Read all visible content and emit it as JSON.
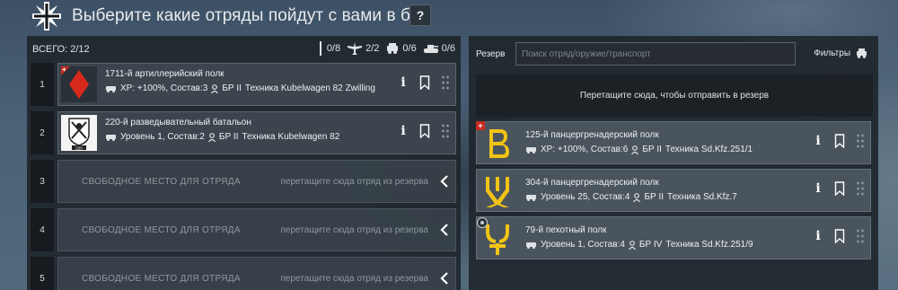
{
  "header": {
    "title": "Выберите какие отряды пойдут с вами в бой",
    "help_label": "?"
  },
  "left": {
    "total_label": "ВСЕГО: 2/12",
    "counts": [
      {
        "icon": "infantry-icon",
        "value": "0/8"
      },
      {
        "icon": "aircraft-icon",
        "value": "2/2"
      },
      {
        "icon": "vehicle-icon",
        "value": "0/6"
      },
      {
        "icon": "tank-icon",
        "value": "0/6"
      }
    ],
    "slots": [
      {
        "number": "1",
        "name": "1711-й артиллерийский полк",
        "info_text": "XP: +100%, Состав:3",
        "br": "БР II",
        "tech": "Техника Kubelwagen 82 Zwilling",
        "emblem": "red-diamond",
        "emblem_color": "#d6291c"
      },
      {
        "number": "2",
        "name": "220-й разведывательный батальон",
        "info_text": "Уровень 1, Состав:2",
        "br": "БР II",
        "tech": "Техника Kubelwagen 82",
        "emblem": "shield-swords",
        "emblem_number": "220"
      },
      {
        "number": "3",
        "empty_label": "СВОБОДНОЕ МЕСТО ДЛЯ ОТРЯДА",
        "hint": "перетащите сюда отряд из резерва"
      },
      {
        "number": "4",
        "empty_label": "СВОБОДНОЕ МЕСТО ДЛЯ ОТРЯДА",
        "hint": "перетащите сюда отряд из резерва"
      },
      {
        "number": "5",
        "empty_label": "СВОБОДНОЕ МЕСТО ДЛЯ ОТРЯДА",
        "hint": "перетащите сюда отряд из резерва"
      }
    ]
  },
  "right": {
    "reserve_label": "Резерв",
    "search_placeholder": "Поиск отряд/оружие/транспорт",
    "filters_label": "Фильтры",
    "dropzone_text": "Перетащите сюда, чтобы отправить в резерв",
    "cards": [
      {
        "name": "125-й панцергренадерский полк",
        "info_text": "XP: +100%, Состав:6",
        "br": "БР II",
        "tech": "Техника Sd.Kfz.251/1",
        "emblem": "yellow-b",
        "badge": "plus"
      },
      {
        "name": "304-й панцергренадерский полк",
        "info_text": "Уровень 25, Состав:4",
        "br": "БР II",
        "tech": "Техника Sd.Kfz.7",
        "emblem": "yellow-rune"
      },
      {
        "name": "79-й пехотный полк",
        "info_text": "Уровень 1, Состав:4",
        "br": "БР IV",
        "tech": "Техника Sd.Kfz.251/9",
        "emblem": "yellow-y",
        "badge": "round"
      }
    ]
  },
  "colors": {
    "accent_red": "#c62a1f",
    "emblem_yellow": "#f1c414"
  }
}
